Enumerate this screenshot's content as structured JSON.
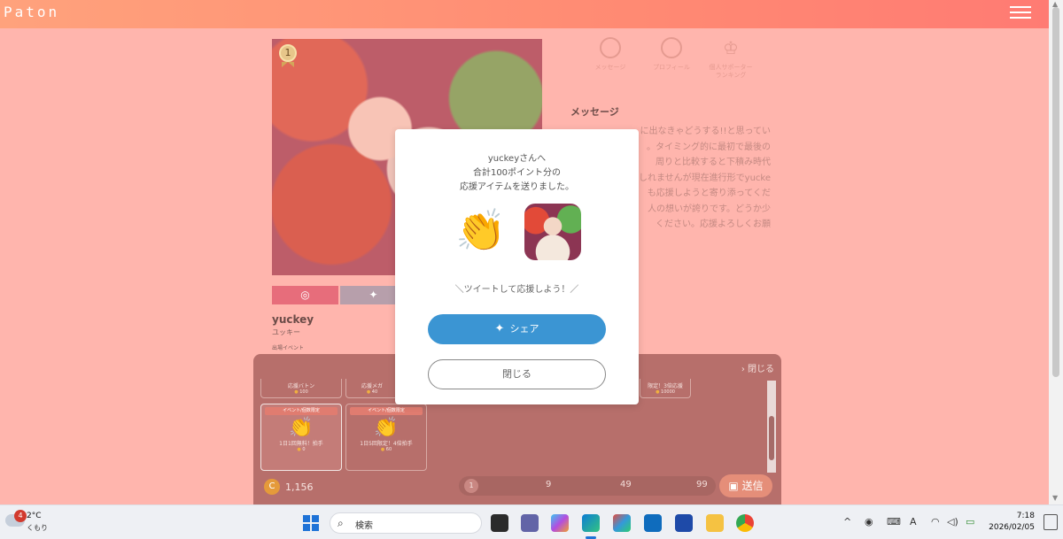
{
  "header": {
    "logo": "Paton"
  },
  "profile": {
    "rank": "1",
    "sns": {
      "instagram_icon": "instagram-icon",
      "twitter_icon": "twitter-icon"
    },
    "name": "yuckey",
    "name_kana": "ユッキー",
    "event_label": "出場イベント"
  },
  "tabs": [
    {
      "label": "メッセージ",
      "icon": "chat-icon"
    },
    {
      "label": "プロフィール",
      "icon": "user-icon"
    },
    {
      "label": "個人サポーター\nランキング",
      "icon": "crown-icon"
    }
  ],
  "message": {
    "title": "メッセージ",
    "lines": [
      "に出なきゃどうする!!と思ってい",
      "。タイミング的に最初で最後の",
      "周りと比較すると下積み時代",
      "しれませんが現在進行形でyucke",
      "も応援しようと寄り添ってくだ",
      "人の想いが誇りです。どうか少",
      "ください。応援よろしくお願"
    ]
  },
  "drawer": {
    "close_label": "閉じる",
    "items_row1": [
      {
        "name": "応援バトン",
        "cost": "100"
      },
      {
        "name": "応援メガ",
        "cost": "40"
      },
      {
        "name": "限定！3倍応援",
        "cost": "10000"
      }
    ],
    "items_row2": [
      {
        "tag": "イベント/個数限定",
        "name": "1日1回無料！拍手",
        "cost": "0"
      },
      {
        "tag": "イベント/個数限定",
        "name": "1日5回限定！4倍拍手",
        "cost": "60"
      }
    ],
    "coin_icon": "C",
    "coin_amount": "1,156",
    "slider_knob": "1",
    "slider_values": [
      "9",
      "49",
      "99"
    ],
    "send_label": "送信"
  },
  "modal": {
    "line1": "yuckeyさんへ",
    "line2": "合計100ポイント分の",
    "line3": "応援アイテムを送りました。",
    "gift_icon": "clapping-hands-icon",
    "tweet_prompt": "＼ツイートして応援しよう！／",
    "share_label": "シェア",
    "close_label": "閉じる"
  },
  "taskbar": {
    "weather_badge": "4",
    "temperature": "2°C",
    "condition": "くもり",
    "search_placeholder": "検索",
    "time": "7:18",
    "date": "2026/02/05",
    "ime": "A"
  }
}
